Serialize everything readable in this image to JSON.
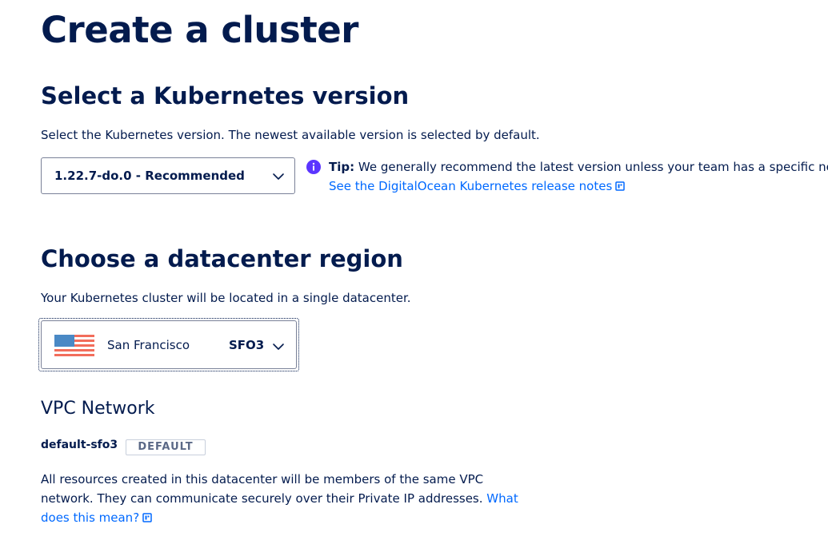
{
  "page": {
    "title": "Create a cluster"
  },
  "kubernetes": {
    "heading": "Select a Kubernetes version",
    "description": "Select the Kubernetes version. The newest available version is selected by default.",
    "selected_version": "1.22.7-do.0 - Recommended",
    "tip_label": "Tip:",
    "tip_text": " We generally recommend the latest version unless your team has a specific need.",
    "release_notes_link": "See the DigitalOcean Kubernetes release notes"
  },
  "region": {
    "heading": "Choose a datacenter region",
    "description": "Your Kubernetes cluster will be located in a single datacenter.",
    "name": "San Francisco",
    "code": "SFO3",
    "flag_icon": "us-flag-icon"
  },
  "vpc": {
    "heading": "VPC Network",
    "network_name": "default-sfo3",
    "badge": "DEFAULT",
    "description_part1": "All resources created in this datacenter will be members of the same VPC network. They can communicate securely over their Private IP addresses.",
    "help_link": "What does this mean?"
  },
  "colors": {
    "text": "#031b4e",
    "link": "#0069ff",
    "info_icon": "#5b35ff",
    "border": "#7a8198"
  }
}
